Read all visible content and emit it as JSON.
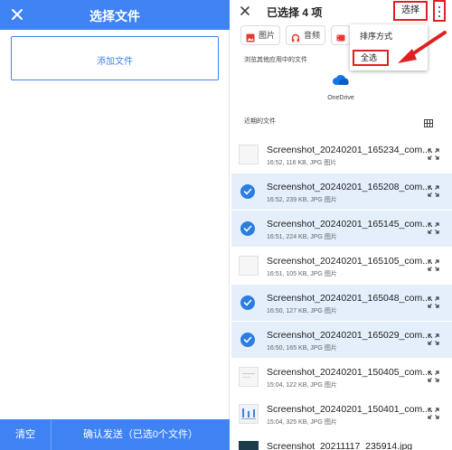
{
  "left_panel": {
    "title": "选择文件",
    "add_label": "添加文件",
    "clear_label": "清空",
    "confirm_label": "确认发送（已选0个文件）",
    "accent": "#3f83f3"
  },
  "right_panel": {
    "title": "已选择 4 项",
    "select_label": "选择",
    "chips": [
      {
        "label": "图片",
        "icon": "image-icon"
      },
      {
        "label": "音频",
        "icon": "headphones-icon"
      },
      {
        "label": "",
        "icon": "video-icon"
      }
    ],
    "browse_label": "浏览其他应用中的文件",
    "onedrive_label": "OneDrive",
    "recent_label": "近期的文件",
    "menu": {
      "sort_label": "排序方式",
      "select_all_label": "全选"
    },
    "files": [
      {
        "name": "Screenshot_20240201_165234_com....",
        "meta": "16:52, 116 KB, JPG 图片",
        "selected": false
      },
      {
        "name": "Screenshot_20240201_165208_com....",
        "meta": "16:52, 239 KB, JPG 图片",
        "selected": true
      },
      {
        "name": "Screenshot_20240201_165145_com....",
        "meta": "16:51, 224 KB, JPG 图片",
        "selected": true
      },
      {
        "name": "Screenshot_20240201_165105_com....",
        "meta": "16:51, 105 KB, JPG 图片",
        "selected": false
      },
      {
        "name": "Screenshot_20240201_165048_com....",
        "meta": "16:50, 127 KB, JPG 图片",
        "selected": true
      },
      {
        "name": "Screenshot_20240201_165029_com....",
        "meta": "16:50, 165 KB, JPG 图片",
        "selected": true
      },
      {
        "name": "Screenshot_20240201_150405_com....",
        "meta": "15:04, 122 KB, JPG 图片",
        "selected": false
      },
      {
        "name": "Screenshot_20240201_150401_com....",
        "meta": "15:04, 325 KB, JPG 图片",
        "selected": false
      },
      {
        "name": "Screenshot_20211117_235914.jpg",
        "meta": "",
        "selected": false
      }
    ],
    "selected_bg": "#e4effb",
    "check_color": "#2b7de1",
    "highlight_color": "#e02020"
  }
}
